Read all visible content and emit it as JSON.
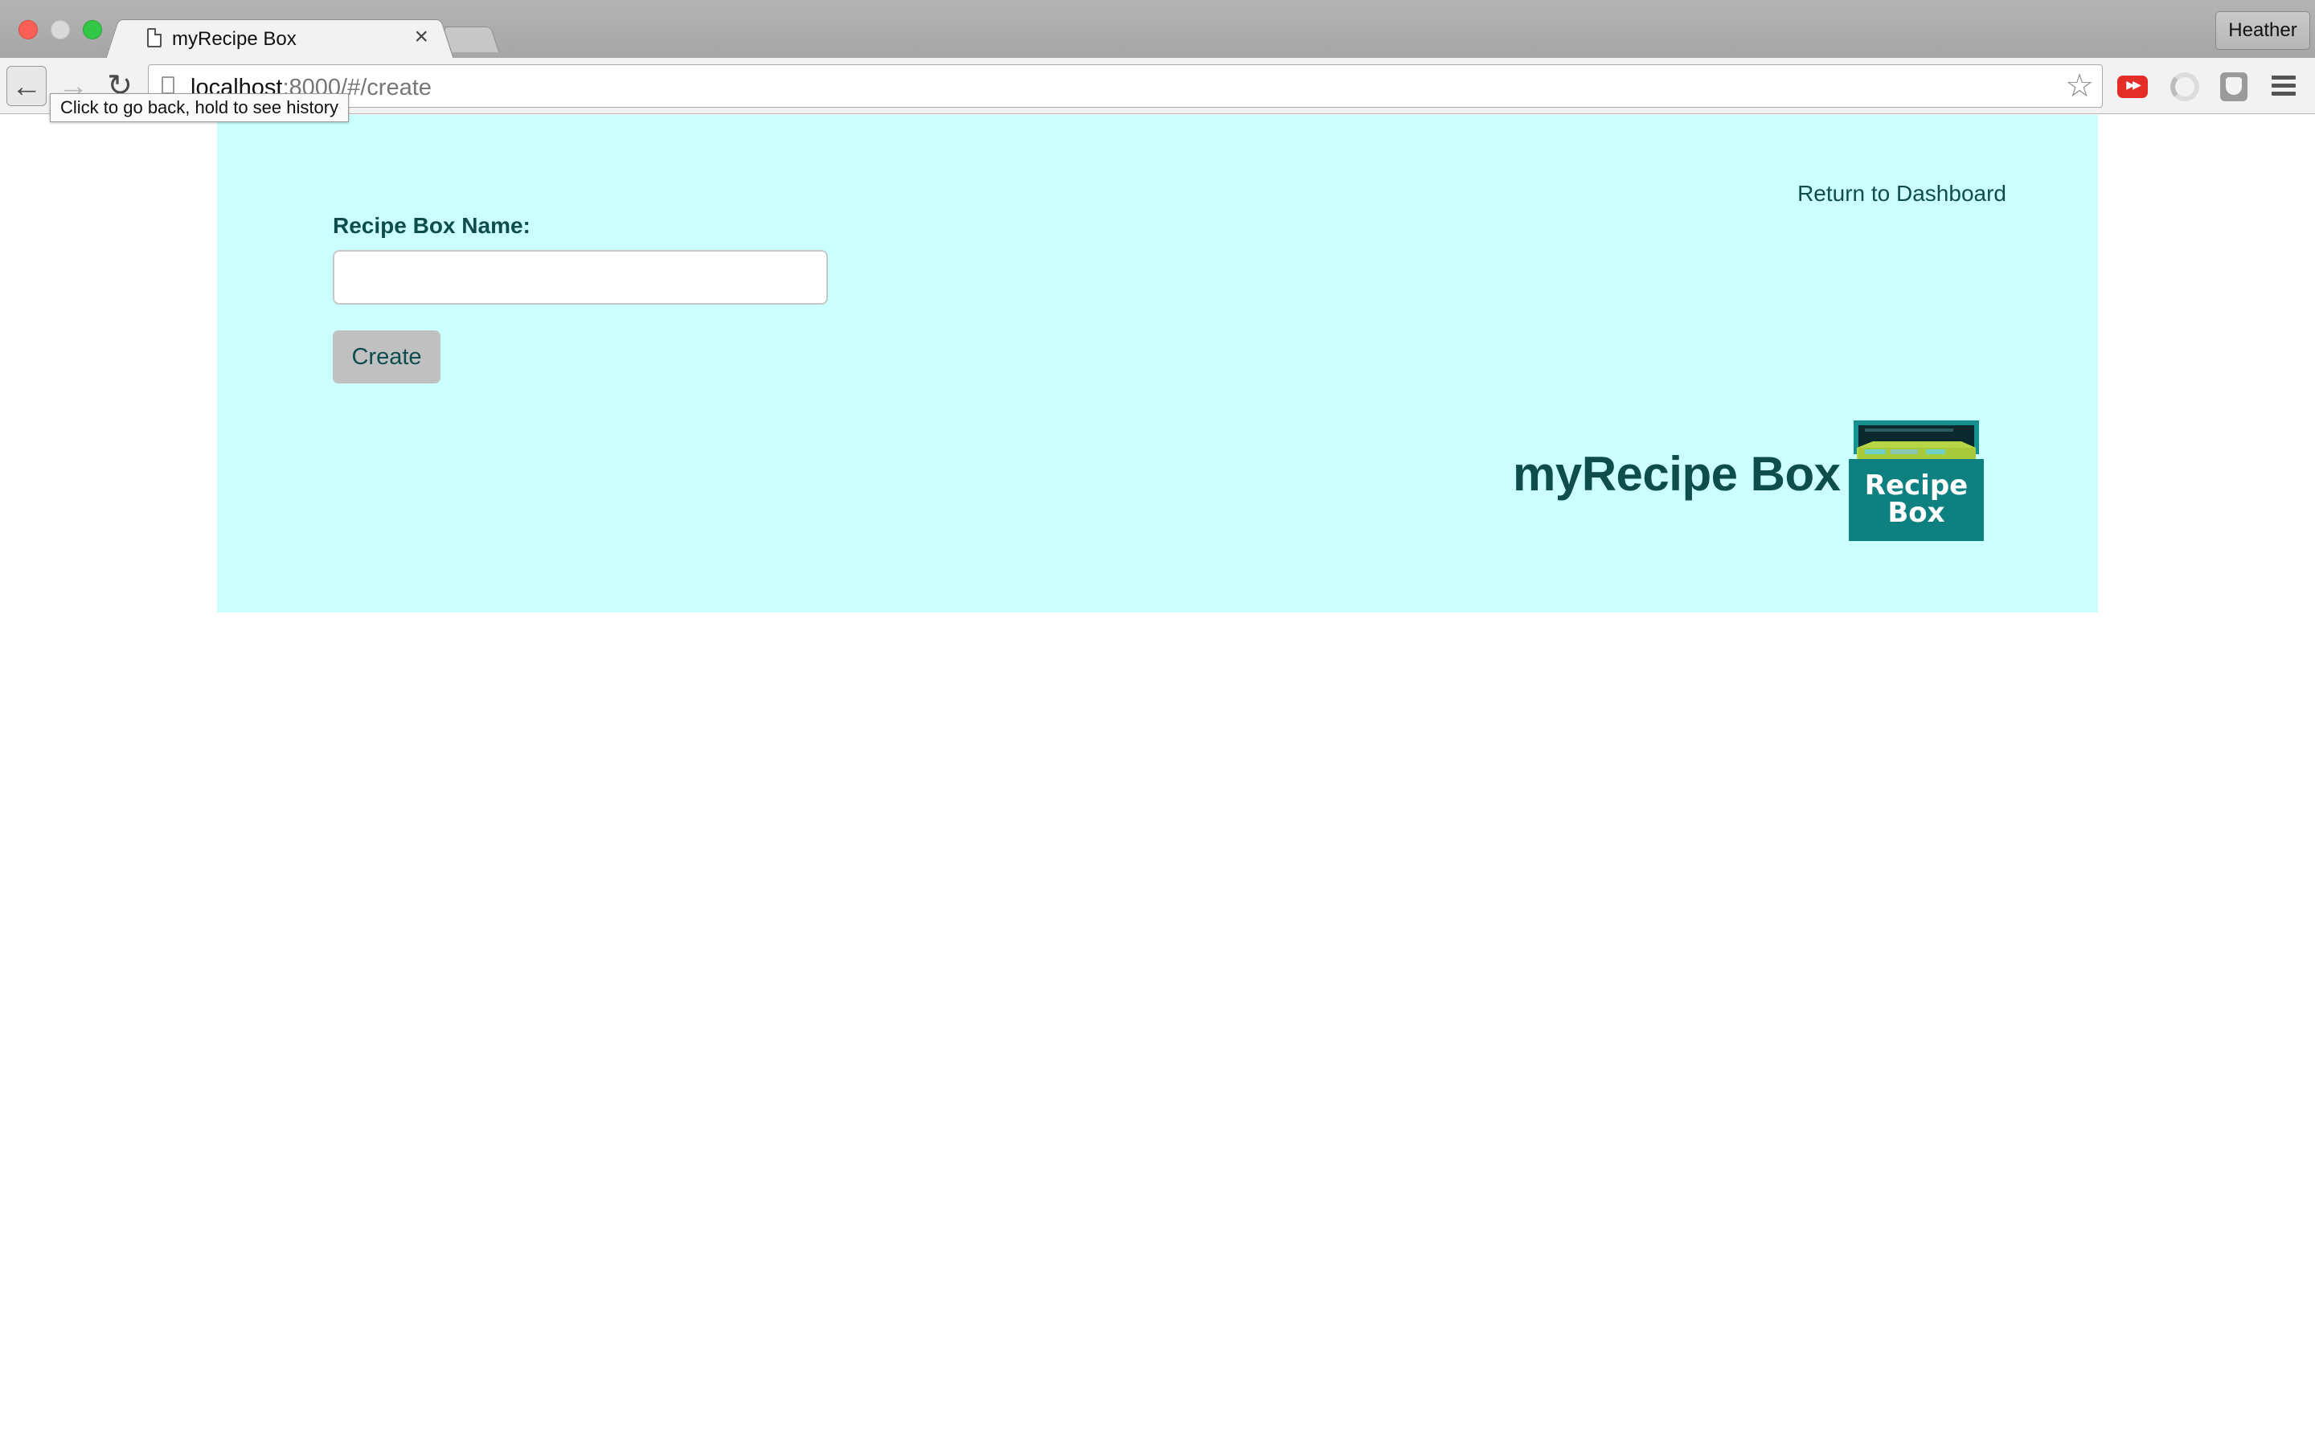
{
  "browser": {
    "tab_title": "myRecipe Box",
    "tab_close": "×",
    "profile_name": "Heather",
    "url_host": "localhost",
    "url_rest": ":8000/#/create",
    "tooltip": "Click to go back, hold to see history",
    "icons": {
      "back": "←",
      "forward": "→",
      "reload": "↻",
      "star": "☆"
    }
  },
  "page": {
    "return_link": "Return to Dashboard",
    "form_label": "Recipe Box Name:",
    "name_input_value": "",
    "name_input_placeholder": "",
    "create_label": "Create",
    "brand_name": "myRecipe Box",
    "logo_text_line1": "Recipe",
    "logo_text_line2": "Box"
  },
  "colors": {
    "panel_bg": "#ccffff",
    "text_dark_teal": "#0e4d4d",
    "button_gray": "#c0c0c0",
    "logo_teal": "#0f8080"
  }
}
